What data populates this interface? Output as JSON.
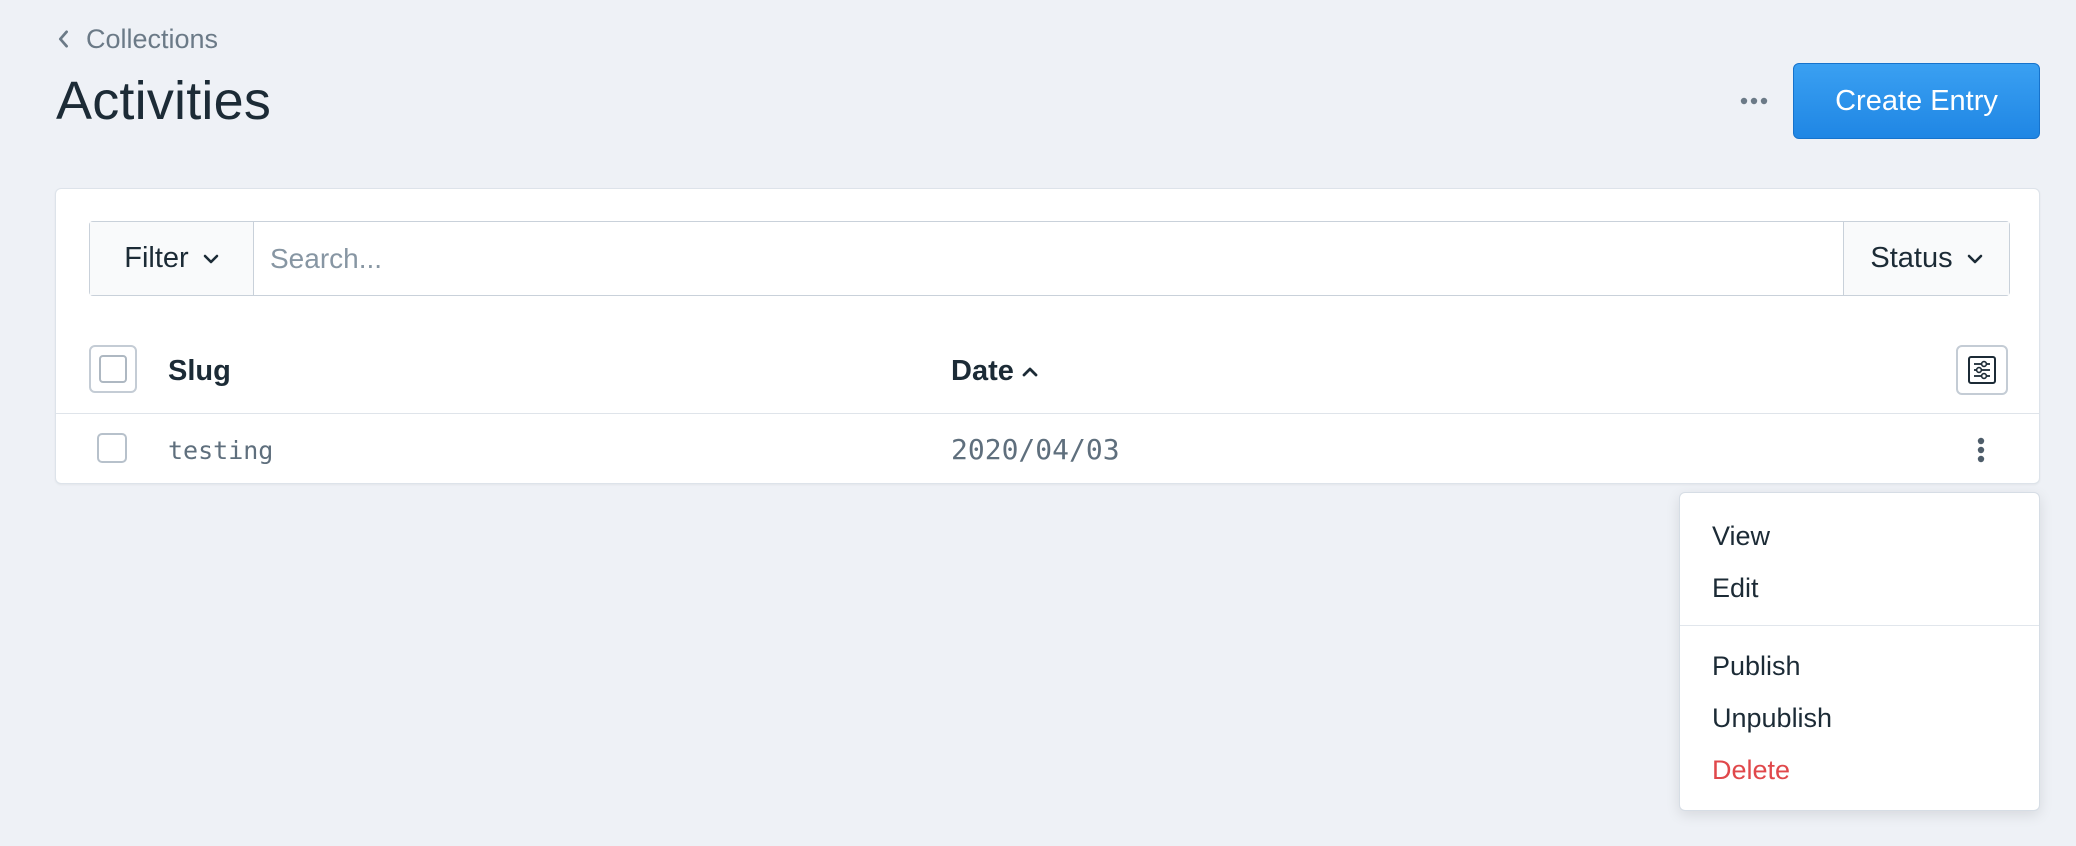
{
  "breadcrumb": {
    "label": "Collections"
  },
  "page": {
    "title": "Activities"
  },
  "actions": {
    "create_label": "Create Entry"
  },
  "filterbar": {
    "filter_label": "Filter",
    "search_placeholder": "Search...",
    "search_value": "",
    "status_label": "Status"
  },
  "table": {
    "columns": [
      {
        "label": "Slug"
      },
      {
        "label": "Date",
        "sort": "ascending"
      }
    ],
    "rows": [
      {
        "slug": "testing",
        "date": "2020/04/03"
      }
    ]
  },
  "row_menu": {
    "items": [
      {
        "label": "View"
      },
      {
        "label": "Edit"
      },
      {
        "label": "Publish"
      },
      {
        "label": "Unpublish"
      },
      {
        "label": "Delete",
        "color": "#e0484b"
      }
    ]
  },
  "colors": {
    "accent": "#2b93ec",
    "danger": "#e0484b",
    "background": "#eef1f6"
  },
  "icons": {
    "back": "chevron-left-icon",
    "more": "more-horizontal-icon",
    "sort": "chevron-up-icon",
    "columns": "sliders-icon",
    "row_more": "more-vertical-icon"
  }
}
